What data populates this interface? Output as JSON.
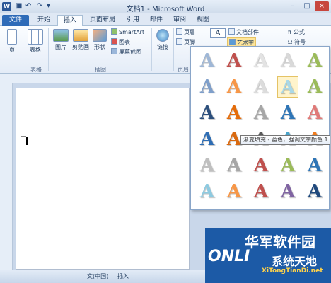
{
  "window": {
    "title": "文档1 - Microsoft Word",
    "app_icon": "W",
    "minimize": "–",
    "maximize": "□",
    "close": "×"
  },
  "qat": {
    "save": "▣",
    "undo": "↶",
    "redo": "↷",
    "customize": "▾"
  },
  "tabs": [
    {
      "label": "文件"
    },
    {
      "label": "开始"
    },
    {
      "label": "插入"
    },
    {
      "label": "页面布局"
    },
    {
      "label": "引用"
    },
    {
      "label": "邮件"
    },
    {
      "label": "审阅"
    },
    {
      "label": "视图"
    }
  ],
  "ribbon": {
    "pages_label": "页",
    "table_label": "表格",
    "tables_group": "表格",
    "picture_label": "图片",
    "clipart_label": "剪贴画",
    "shapes_label": "形状",
    "smartart_label": "SmartArt",
    "chart_label": "图表",
    "screenshot_label": "屏幕截图",
    "illustrations_group": "插图",
    "link_label": "链接",
    "header_label": "页眉",
    "footer_label": "页脚",
    "header_footer_group": "页眉",
    "textbox_label": "A",
    "docparts_label": "文档部件",
    "wordart_label": "艺术字",
    "equation_label": "公式",
    "symbol_label": "符号",
    "equation_icon": "π",
    "symbol_icon": "Ω"
  },
  "status": {
    "language": "文(中国)",
    "mode": "插入"
  },
  "gallery": {
    "letter": "A",
    "tooltip": "渐变填充 - 蓝色，强调文字颜色 1",
    "selected_index": 8,
    "colors": [
      [
        "#9fb7d6",
        "#c0504d",
        "#e3e3e3",
        "#d9d9d9",
        "#9bbb59"
      ],
      [
        "#7f9fca",
        "#f79646",
        "#dcdcdc",
        "#a9d8e8",
        "#9bbb59"
      ],
      [
        "#2c4f7c",
        "#e46c0a",
        "#a6a6a6",
        "#2e75b6",
        "#e07a78"
      ],
      [
        "#2e6db4",
        "#d9690f",
        "#595959",
        "#4aa3c9",
        "#f07c1e"
      ],
      [
        "#bfbfbf",
        "#a6a6a6",
        "#c0504d",
        "#9bbb59",
        "#2e75b6"
      ],
      [
        "#8ecae0",
        "#f79646",
        "#c0504d",
        "#8064a2",
        "#1f497d"
      ]
    ]
  },
  "watermark": {
    "cn": "华军软件园",
    "onl": "ONLI",
    "site_cn": "系统天地",
    "url": "XiTongTianDi.net"
  }
}
